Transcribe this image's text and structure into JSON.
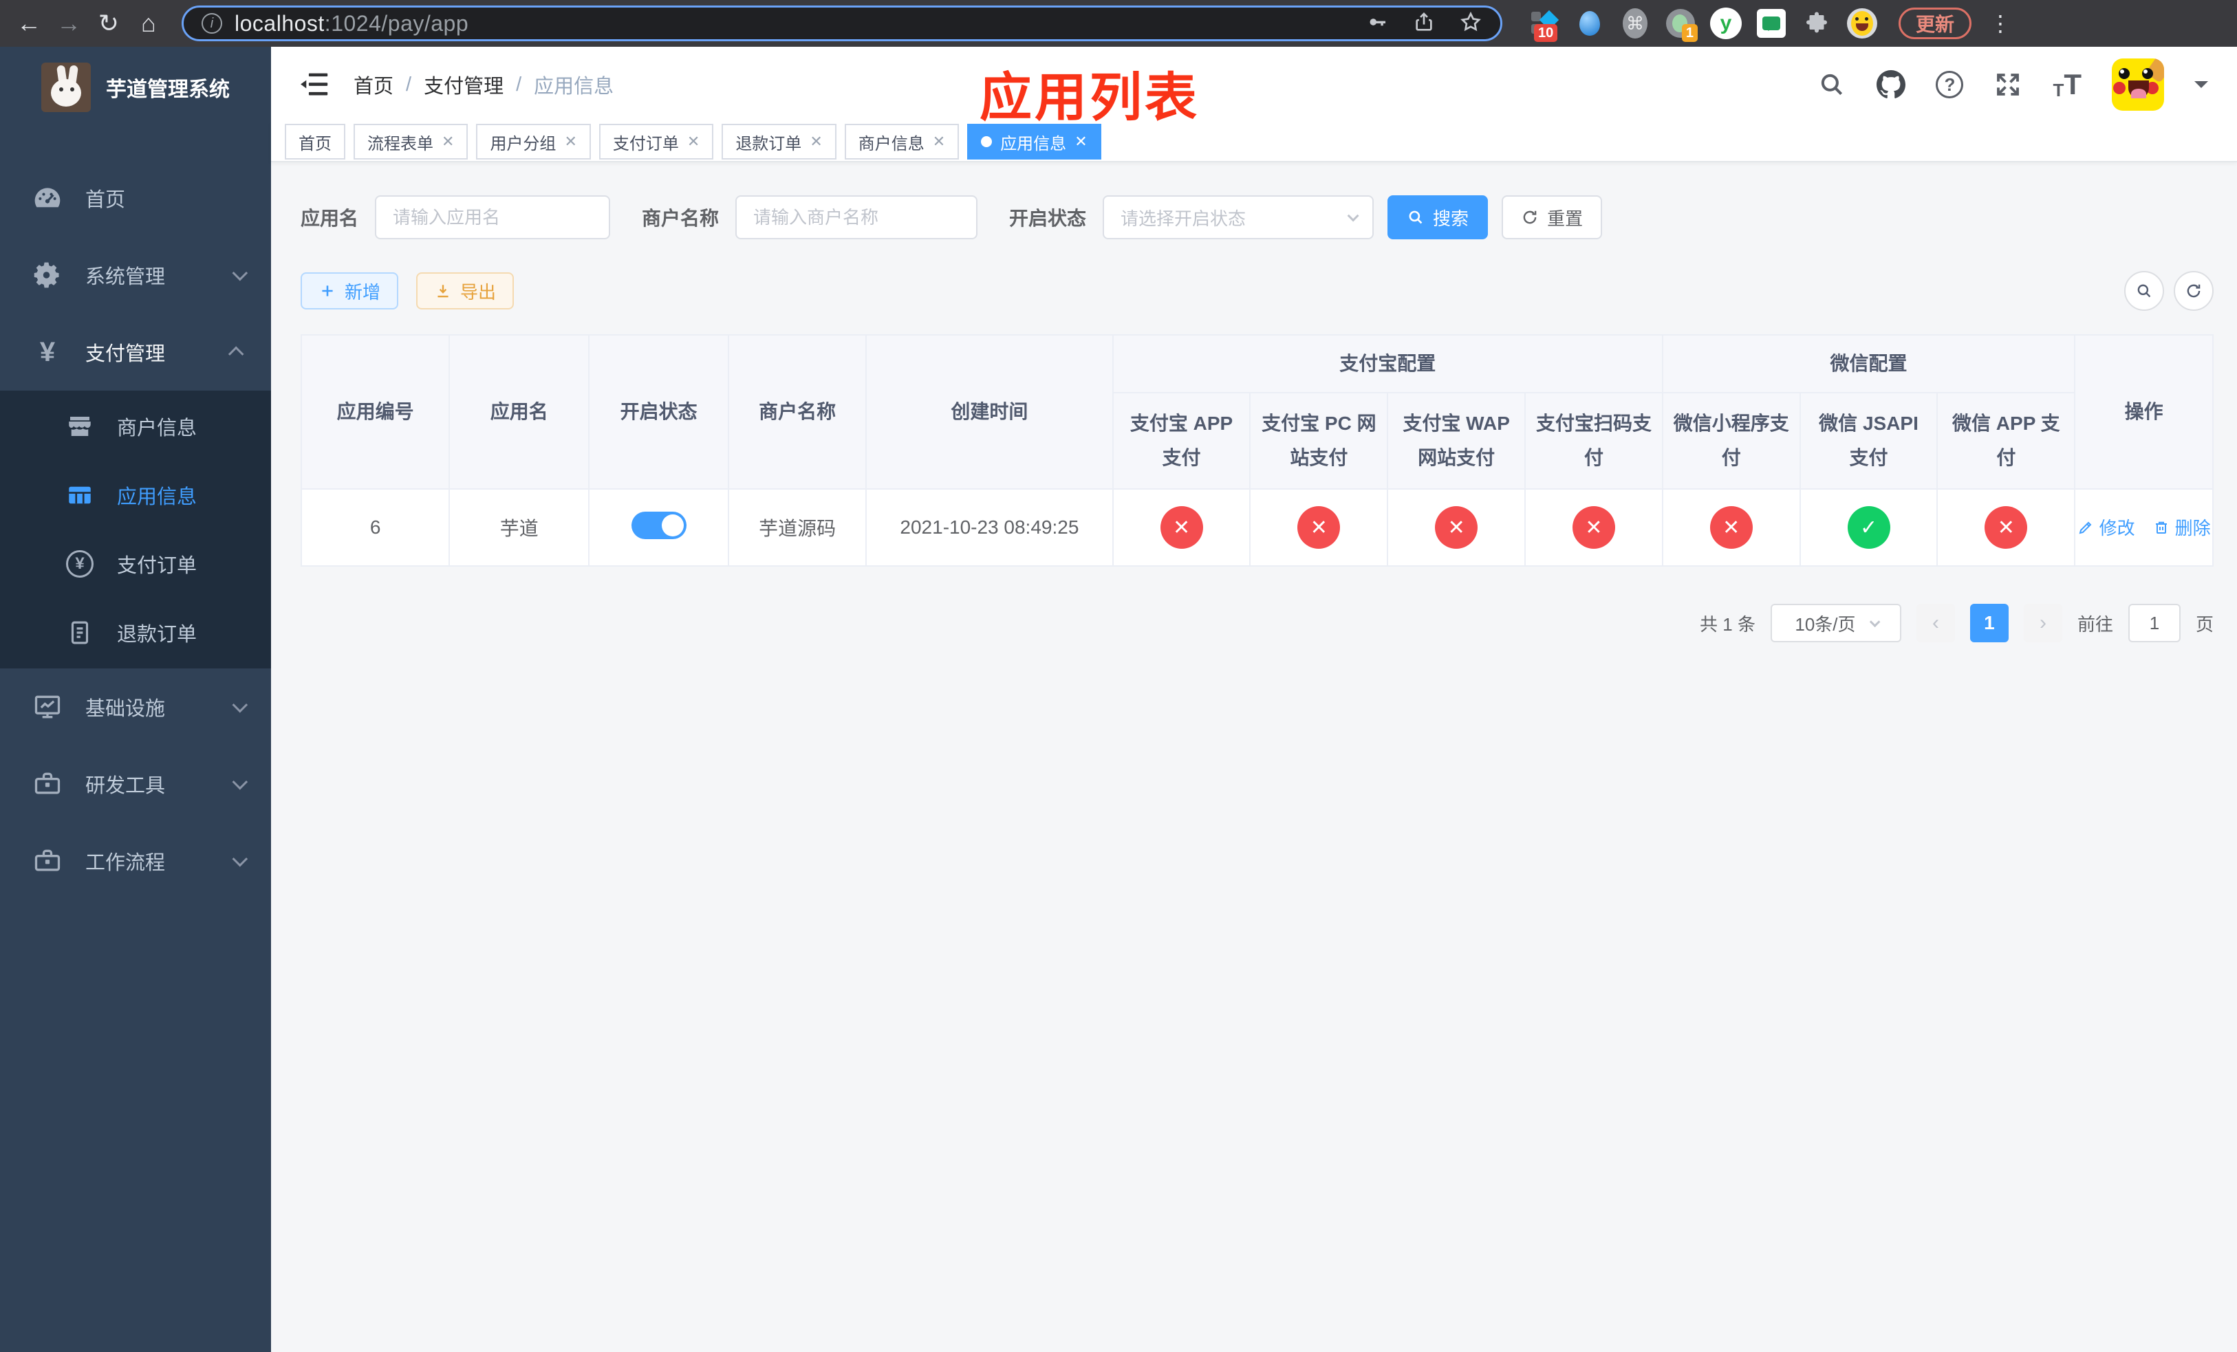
{
  "colors": {
    "accent": "#409eff",
    "success": "#13ce66",
    "danger": "#f44d4f",
    "warning": "#e6a23c",
    "annotation_red": "#f93317",
    "sidebar_bg": "#304156",
    "submenu_bg": "#1f2d3d"
  },
  "browser": {
    "url_host": "localhost",
    "url_path": ":1024/pay/app",
    "update_label": "更新",
    "pin_badge": "10",
    "profile_badge": "1"
  },
  "app": {
    "title": "芋道管理系统"
  },
  "sidebar": {
    "items": [
      {
        "label": "首页"
      },
      {
        "label": "系统管理"
      },
      {
        "label": "支付管理"
      },
      {
        "label": "商户信息"
      },
      {
        "label": "应用信息"
      },
      {
        "label": "支付订单"
      },
      {
        "label": "退款订单"
      },
      {
        "label": "基础设施"
      },
      {
        "label": "研发工具"
      },
      {
        "label": "工作流程"
      }
    ]
  },
  "header": {
    "breadcrumb": [
      "首页",
      "支付管理",
      "应用信息"
    ],
    "separator": "/",
    "annotation": "应用列表"
  },
  "tags": [
    {
      "label": "首页",
      "active": false
    },
    {
      "label": "流程表单",
      "active": false
    },
    {
      "label": "用户分组",
      "active": false
    },
    {
      "label": "支付订单",
      "active": false
    },
    {
      "label": "退款订单",
      "active": false
    },
    {
      "label": "商户信息",
      "active": false
    },
    {
      "label": "应用信息",
      "active": true
    }
  ],
  "filters": {
    "app_name_label": "应用名",
    "app_name_placeholder": "请输入应用名",
    "merchant_label": "商户名称",
    "merchant_placeholder": "请输入商户名称",
    "status_label": "开启状态",
    "status_placeholder": "请选择开启状态",
    "search_label": "搜索",
    "reset_label": "重置"
  },
  "toolbar": {
    "add_label": "新增",
    "export_label": "导出"
  },
  "table": {
    "headers": {
      "app_id": "应用编号",
      "app_name": "应用名",
      "status": "开启状态",
      "merchant": "商户名称",
      "created": "创建时间",
      "alipay_group": "支付宝配置",
      "wechat_group": "微信配置",
      "actions": "操作"
    },
    "sub_headers": [
      "支付宝 APP 支付",
      "支付宝 PC 网站支付",
      "支付宝 WAP 网站支付",
      "支付宝扫码支付",
      "微信小程序支付",
      "微信 JSAPI 支付",
      "微信 APP 支付"
    ],
    "row": {
      "app_id": "6",
      "app_name": "芋道",
      "enabled": true,
      "merchant": "芋道源码",
      "created": "2021-10-23 08:49:25",
      "pay_status": [
        false,
        false,
        false,
        false,
        false,
        true,
        false
      ],
      "edit_label": "修改",
      "delete_label": "删除"
    }
  },
  "pagination": {
    "total": "共 1 条",
    "page_size": "10条/页",
    "current": "1",
    "goto_label": "前往",
    "goto_value": "1",
    "page_unit": "页"
  }
}
